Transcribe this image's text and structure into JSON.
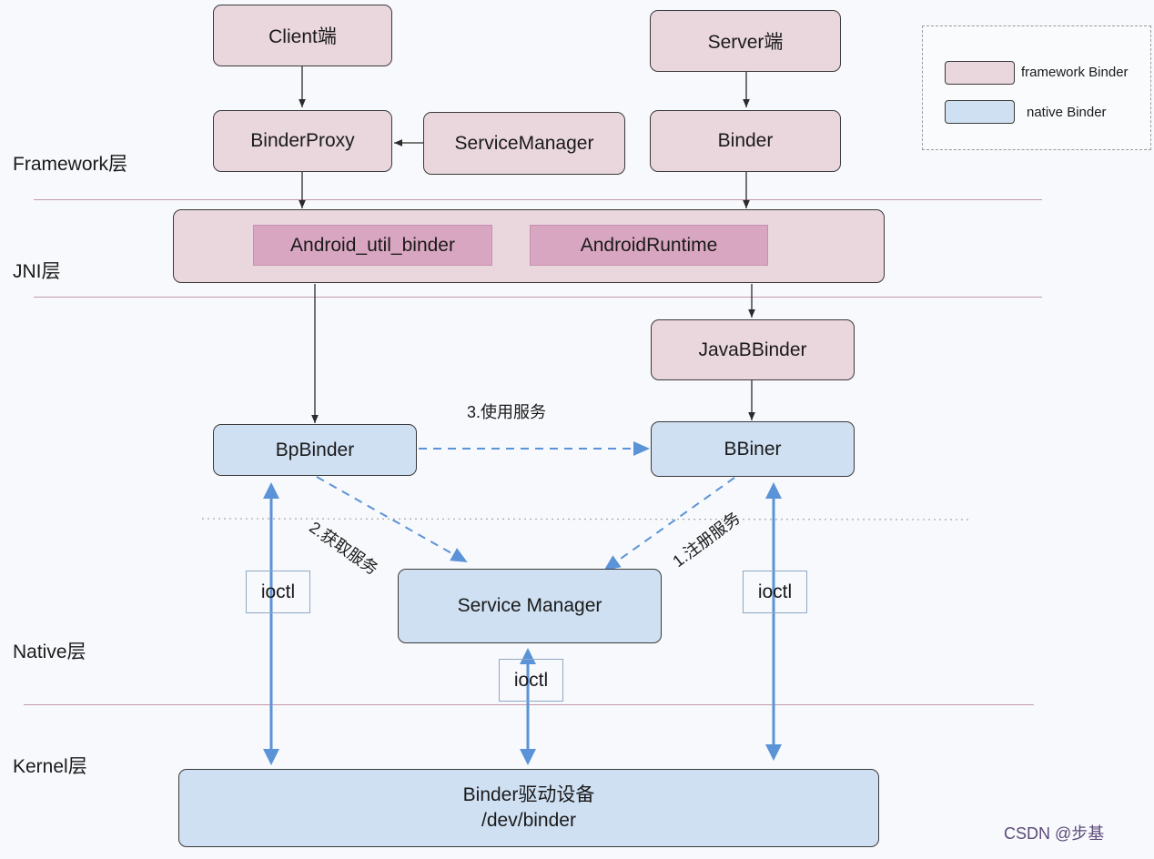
{
  "layers": {
    "framework": "Framework层",
    "jni": "JNI层",
    "native": "Native层",
    "kernel": "Kernel层"
  },
  "framework_nodes": {
    "client": "Client端",
    "server": "Server端",
    "binder_proxy": "BinderProxy",
    "service_manager_java": "ServiceManager",
    "binder": "Binder"
  },
  "jni_nodes": {
    "android_util_binder": "Android_util_binder",
    "android_runtime": "AndroidRuntime",
    "java_bbinder": "JavaBBinder"
  },
  "native_nodes": {
    "bp_binder": "BpBinder",
    "bbinder": "BBiner",
    "service_manager": "Service Manager"
  },
  "kernel_nodes": {
    "driver_line1": "Binder驱动设备",
    "driver_line2": "/dev/binder"
  },
  "edge_labels": {
    "use_service": "3.使用服务",
    "get_service": "2.获取服务",
    "register_service": "1.注册服务",
    "ioctl_left": "ioctl",
    "ioctl_center": "ioctl",
    "ioctl_right": "ioctl"
  },
  "legend": {
    "items": [
      {
        "label": "framework Binder",
        "color": "#ead7de"
      },
      {
        "label": "native Binder",
        "color": "#cfe0f3"
      }
    ]
  },
  "colors": {
    "framework_fill": "#ead7de",
    "jni_inner_fill": "#d9a6c1",
    "native_fill": "#cfe0f3",
    "arrow_blue": "#5b93d8",
    "layer_line": "#c49aa8"
  },
  "watermark": "CSDN @步基"
}
